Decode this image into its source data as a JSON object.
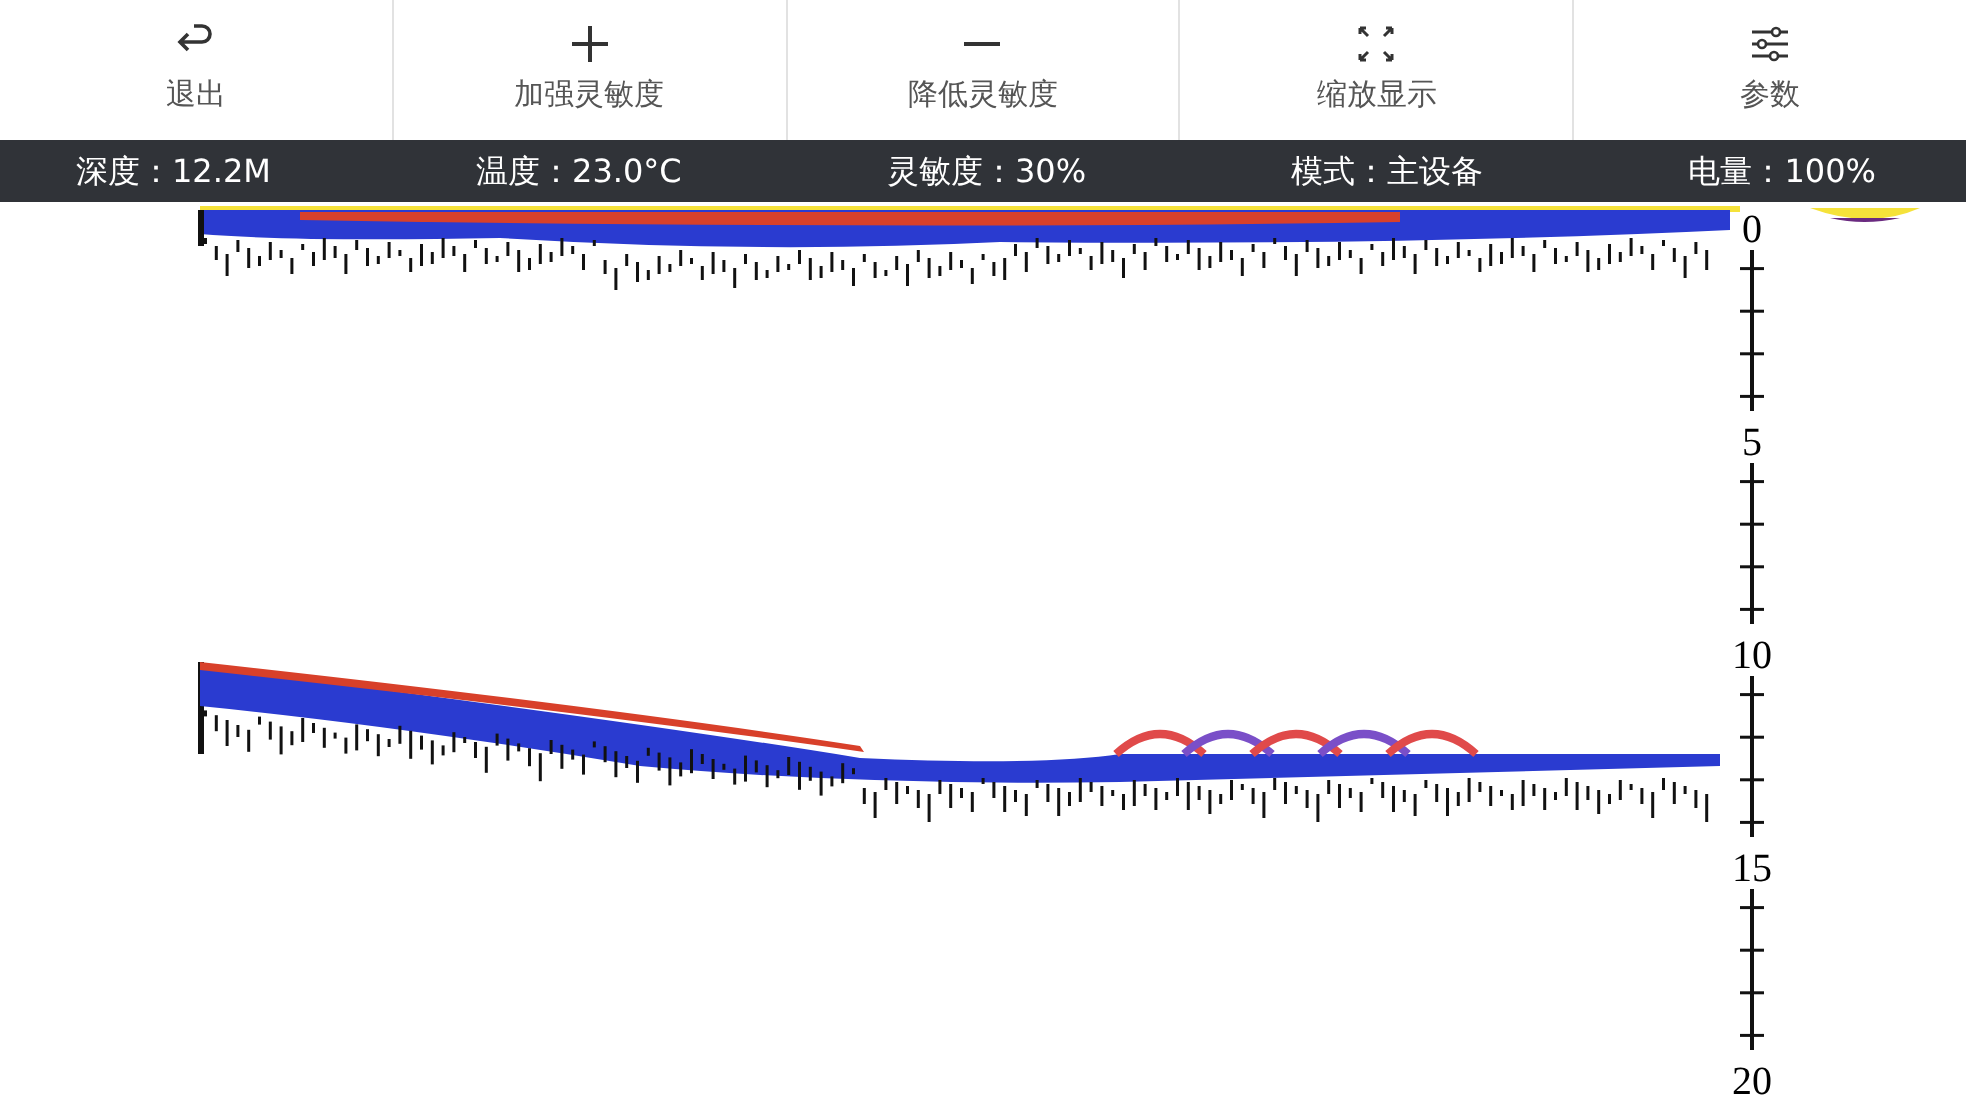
{
  "toolbar": [
    {
      "kind": "back",
      "label": "退出"
    },
    {
      "kind": "plus",
      "label": "加强灵敏度"
    },
    {
      "kind": "minus",
      "label": "降低灵敏度"
    },
    {
      "kind": "zoom",
      "label": "缩放显示"
    },
    {
      "kind": "sliders",
      "label": "参数"
    }
  ],
  "status_bar": [
    {
      "label": "深度：",
      "value": "12.2M"
    },
    {
      "label": "温度：",
      "value": "23.0°C"
    },
    {
      "label": "灵敏度：",
      "value": "30%"
    },
    {
      "label": "模式：",
      "value": "主设备"
    },
    {
      "label": "电量：",
      "value": "100%"
    }
  ],
  "depth_scale": {
    "labels": [
      "0",
      "5",
      "10",
      "15",
      "20"
    ]
  }
}
